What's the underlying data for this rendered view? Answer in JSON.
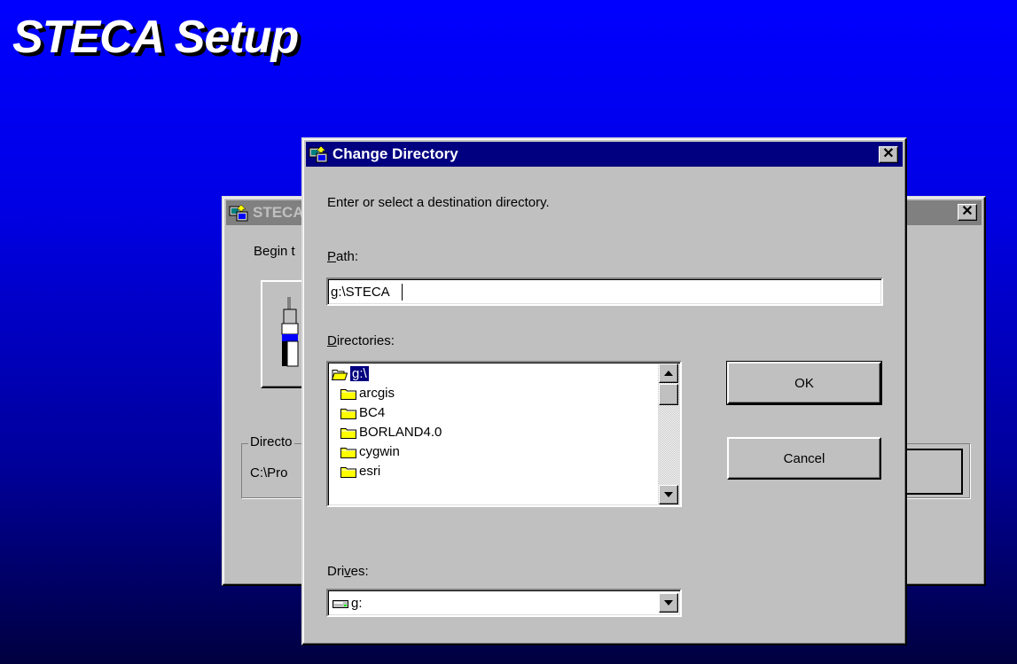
{
  "desktop": {
    "title": "STECA Setup"
  },
  "background_window": {
    "title": "STECA",
    "begin_text": "Begin t",
    "directory_group_label": "Directo",
    "directory_value": "C:\\Pro"
  },
  "dialog": {
    "title": "Change Directory",
    "instruction": "Enter or select a destination directory.",
    "path": {
      "label_underlined": "P",
      "label_rest": "ath:",
      "value": "g:\\STECA"
    },
    "directories": {
      "label_underlined": "D",
      "label_rest": "irectories:",
      "items": [
        {
          "label": "g:\\",
          "selected": true,
          "open": true
        },
        {
          "label": "arcgis"
        },
        {
          "label": "BC4"
        },
        {
          "label": "BORLAND4.0"
        },
        {
          "label": "cygwin"
        },
        {
          "label": "esri"
        }
      ]
    },
    "drives": {
      "label_prefix": "Dri",
      "label_underlined": "v",
      "label_rest": "es:",
      "value": "g:"
    },
    "ok_label": "OK",
    "cancel_label": "Cancel"
  },
  "colors": {
    "titlebar_active": "#000080",
    "titlebar_inactive": "#808080",
    "face": "#c0c0c0",
    "desktop_gradient_top": "#0000ff",
    "desktop_gradient_bottom": "#000040"
  }
}
